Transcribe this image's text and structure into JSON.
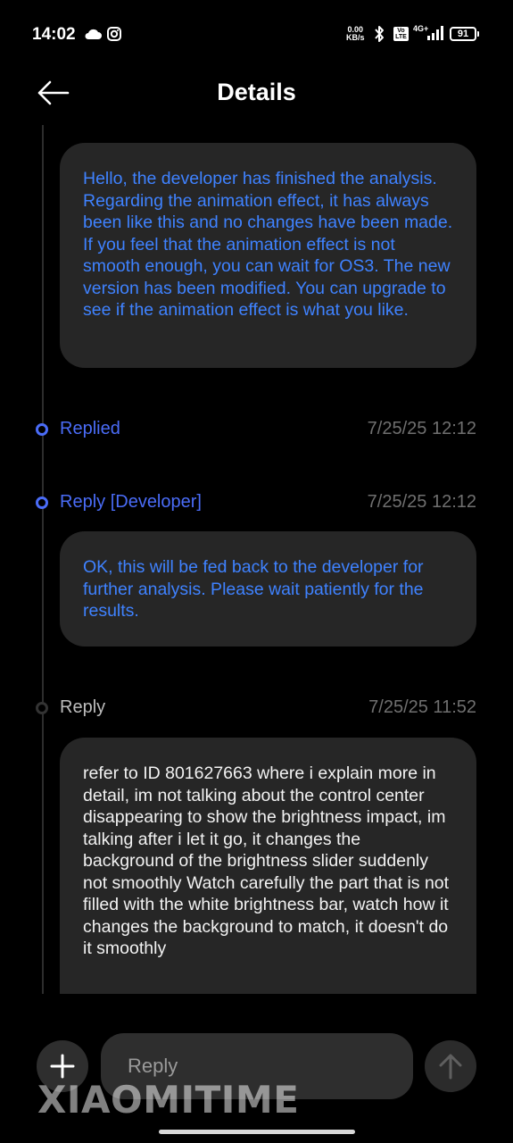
{
  "status_bar": {
    "time": "14:02",
    "net_speed_value": "0.00",
    "net_speed_unit": "KB/s",
    "volte": "Vo LTE",
    "network": "4G+",
    "battery": "91"
  },
  "header": {
    "title": "Details"
  },
  "messages": [
    {
      "text": "Hello, the developer has finished the analysis. Regarding the animation effect, it has always been like this and no changes have been made. If you feel that the animation effect is not smooth enough, you can wait for OS3. The new version has been modified. You can upgrade to see if the animation effect is what you like."
    },
    {
      "text": "OK, this will be fed back to the developer for further analysis. Please wait patiently for the results."
    },
    {
      "text": "refer to ID 801627663 where i explain more in detail, im not talking about the control center disappearing to show the brightness impact, im talking after i let it go, it changes the background of the brightness slider suddenly not smoothly Watch carefully the part that is not filled with the white brightness bar, watch how it changes the background to match, it doesn't do it smoothly"
    }
  ],
  "events": [
    {
      "label": "Replied",
      "time": "7/25/25 12:12"
    },
    {
      "label": "Reply [Developer]",
      "time": "7/25/25 12:12"
    },
    {
      "label": "Reply",
      "time": "7/25/25 11:52"
    }
  ],
  "composer": {
    "placeholder": "Reply"
  },
  "watermark": "XIAOMITIME",
  "colors": {
    "accent": "#4a6cf7",
    "developer_text": "#3f82ff",
    "bubble": "#262626",
    "background": "#000000"
  }
}
